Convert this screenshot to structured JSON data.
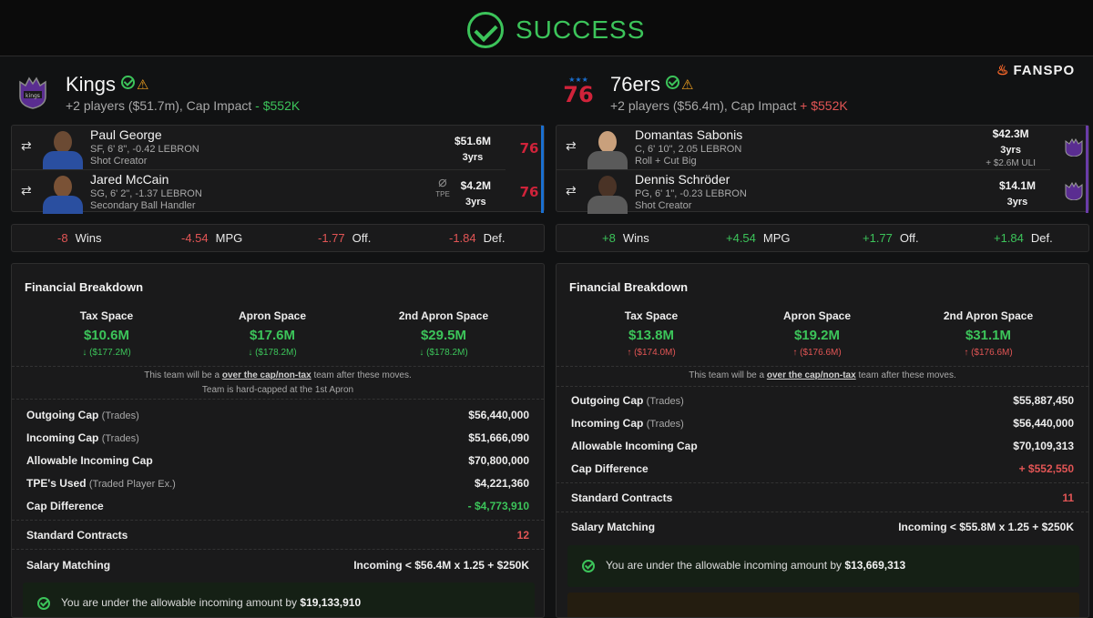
{
  "banner": {
    "title": "SUCCESS"
  },
  "brand": {
    "name": "FANSPO"
  },
  "teams": [
    {
      "name": "Kings",
      "sub_players": "+2 players ($51.7m), Cap Impact",
      "sub_impact": " - $552K",
      "players": [
        {
          "name": "Paul George",
          "info": "SF, 6' 8\", -0.42 LEBRON",
          "role": "Shot Creator",
          "amount": "$51.6M",
          "years": "3yrs",
          "uli": ""
        },
        {
          "name": "Jared McCain",
          "info": "SG, 6' 2\", -1.37 LEBRON",
          "role": "Secondary Ball Handler",
          "amount": "$4.2M",
          "years": "3yrs",
          "tpe": "TPE",
          "uli": ""
        }
      ],
      "dest_team": "76ers",
      "stats": [
        {
          "value": "-8",
          "label": "Wins"
        },
        {
          "value": "-4.54",
          "label": "MPG"
        },
        {
          "value": "-1.77",
          "label": "Off."
        },
        {
          "value": "-1.84",
          "label": "Def."
        }
      ],
      "financial": {
        "title": "Financial Breakdown",
        "spaces": [
          {
            "label": "Tax Space",
            "value": "$10.6M",
            "change": "↓ ($177.2M)"
          },
          {
            "label": "Apron Space",
            "value": "$17.6M",
            "change": "↓ ($178.2M)"
          },
          {
            "label": "2nd Apron Space",
            "value": "$29.5M",
            "change": "↓ ($178.2M)"
          }
        ],
        "note_pre": "This team will be a ",
        "note_link": "over the cap/non-tax",
        "note_post": " team after these moves.",
        "hard_cap": "Team is hard-capped at the 1st Apron",
        "rows": [
          {
            "key": "Outgoing Cap",
            "small": "(Trades)",
            "value": "$56,440,000"
          },
          {
            "key": "Incoming Cap",
            "small": "(Trades)",
            "value": "$51,666,090"
          },
          {
            "key": "Allowable Incoming Cap",
            "small": "",
            "value": "$70,800,000"
          },
          {
            "key": "TPE's Used",
            "small": "(Traded Player Ex.)",
            "value": "$4,221,360"
          },
          {
            "key": "Cap Difference",
            "small": "",
            "value": "- $4,773,910"
          }
        ],
        "standard_contracts": {
          "key": "Standard Contracts",
          "value": "12"
        },
        "salary_matching": {
          "key": "Salary Matching",
          "value": "Incoming < $56.4M x 1.25 + $250K"
        },
        "ok_text": "You are under the allowable incoming amount by ",
        "ok_amount": "$19,133,910"
      }
    },
    {
      "name": "76ers",
      "sub_players": "+2 players ($56.4m), Cap Impact",
      "sub_impact": " + $552K",
      "players": [
        {
          "name": "Domantas Sabonis",
          "info": "C, 6' 10\", 2.05 LEBRON",
          "role": "Roll + Cut Big",
          "amount": "$42.3M",
          "years": "3yrs",
          "uli": "+ $2.6M ULI"
        },
        {
          "name": "Dennis Schröder",
          "info": "PG, 6' 1\", -0.23 LEBRON",
          "role": "Shot Creator",
          "amount": "$14.1M",
          "years": "3yrs",
          "uli": ""
        }
      ],
      "dest_team": "Kings",
      "stats": [
        {
          "value": "+8",
          "label": "Wins"
        },
        {
          "value": "+4.54",
          "label": "MPG"
        },
        {
          "value": "+1.77",
          "label": "Off."
        },
        {
          "value": "+1.84",
          "label": "Def."
        }
      ],
      "financial": {
        "title": "Financial Breakdown",
        "spaces": [
          {
            "label": "Tax Space",
            "value": "$13.8M",
            "change": "↑ ($174.0M)"
          },
          {
            "label": "Apron Space",
            "value": "$19.2M",
            "change": "↑ ($176.6M)"
          },
          {
            "label": "2nd Apron Space",
            "value": "$31.1M",
            "change": "↑ ($176.6M)"
          }
        ],
        "note_pre": "This team will be a ",
        "note_link": "over the cap/non-tax",
        "note_post": " team after these moves.",
        "rows": [
          {
            "key": "Outgoing Cap",
            "small": "(Trades)",
            "value": "$55,887,450"
          },
          {
            "key": "Incoming Cap",
            "small": "(Trades)",
            "value": "$56,440,000"
          },
          {
            "key": "Allowable Incoming Cap",
            "small": "",
            "value": "$70,109,313"
          },
          {
            "key": "Cap Difference",
            "small": "",
            "value": "+ $552,550"
          }
        ],
        "standard_contracts": {
          "key": "Standard Contracts",
          "value": "11"
        },
        "salary_matching": {
          "key": "Salary Matching",
          "value": "Incoming < $55.8M x 1.25 + $250K"
        },
        "ok_text": "You are under the allowable incoming amount by ",
        "ok_amount": "$13,669,313"
      }
    }
  ],
  "colors": {
    "success": "#3cc45a",
    "negative": "#e25555",
    "warning": "#f0a020",
    "sixers": "#1a6fd0",
    "kings": "#6a3ca8"
  }
}
